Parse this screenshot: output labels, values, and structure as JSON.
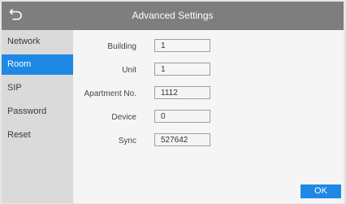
{
  "header": {
    "title": "Advanced Settings",
    "back_icon": "back-arrow-icon"
  },
  "sidebar": {
    "items": [
      {
        "label": "Network",
        "active": false
      },
      {
        "label": "Room",
        "active": true
      },
      {
        "label": "SIP",
        "active": false
      },
      {
        "label": "Password",
        "active": false
      },
      {
        "label": "Reset",
        "active": false
      }
    ]
  },
  "form": {
    "fields": [
      {
        "label": "Building",
        "value": "1"
      },
      {
        "label": "Unit",
        "value": "1"
      },
      {
        "label": "Apartment No.",
        "value": "1112"
      },
      {
        "label": "Device",
        "value": "0"
      },
      {
        "label": "Sync",
        "value": "527642"
      }
    ]
  },
  "footer": {
    "ok_label": "OK"
  },
  "colors": {
    "accent": "#1e88e5",
    "titlebar": "#7e7e7e",
    "sidebar": "#dadada",
    "content": "#f5f5f5"
  }
}
